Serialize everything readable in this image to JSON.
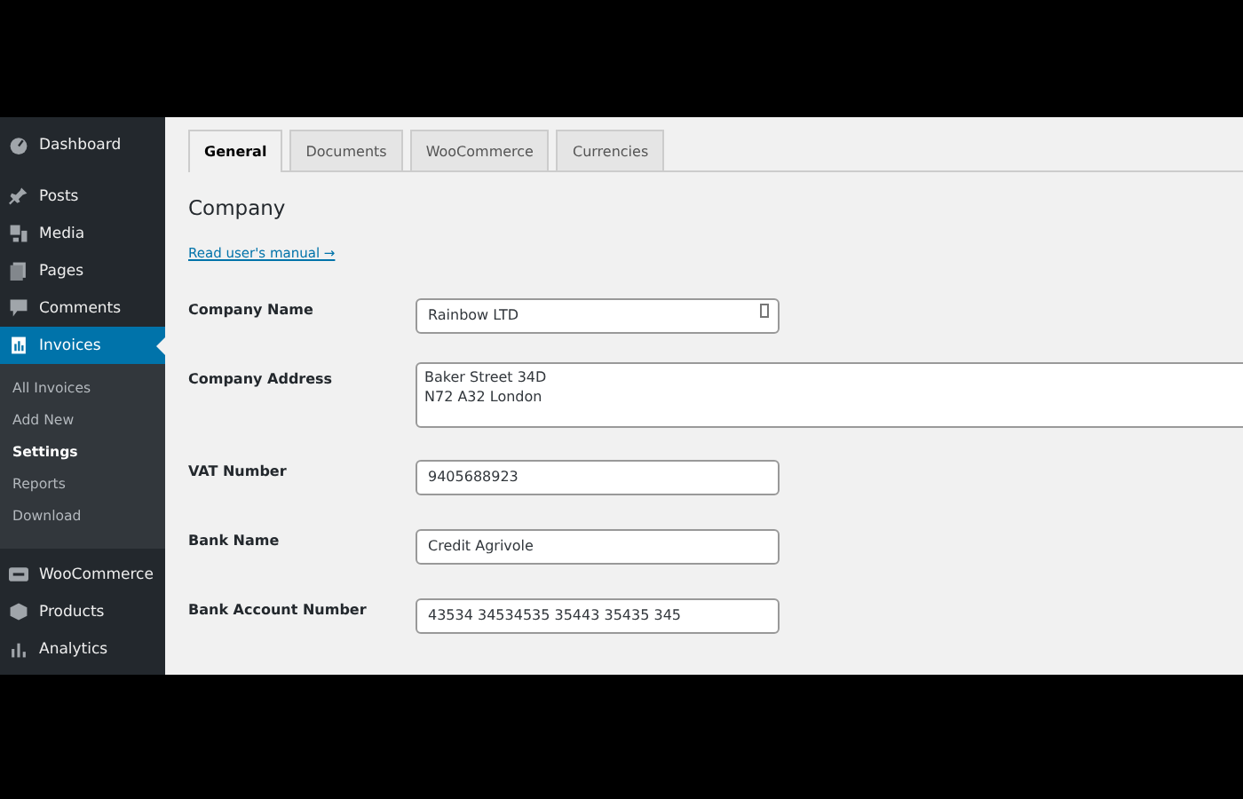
{
  "sidebar": {
    "items": [
      {
        "label": "Dashboard",
        "selected": false
      },
      {
        "label": "Posts",
        "selected": false
      },
      {
        "label": "Media",
        "selected": false
      },
      {
        "label": "Pages",
        "selected": false
      },
      {
        "label": "Comments",
        "selected": false
      },
      {
        "label": "Invoices",
        "selected": true,
        "expanded": true,
        "children": [
          {
            "label": "All Invoices",
            "selected": false
          },
          {
            "label": "Add New",
            "selected": false
          },
          {
            "label": "Settings",
            "selected": true
          },
          {
            "label": "Reports",
            "selected": false
          },
          {
            "label": "Download",
            "selected": false
          }
        ]
      },
      {
        "label": "WooCommerce",
        "selected": false
      },
      {
        "label": "Products",
        "selected": false
      },
      {
        "label": "Analytics",
        "selected": false
      }
    ]
  },
  "tabs": [
    {
      "label": "General",
      "selected": true
    },
    {
      "label": "Documents",
      "selected": false
    },
    {
      "label": "WooCommerce",
      "selected": false
    },
    {
      "label": "Currencies",
      "selected": false
    }
  ],
  "section_title": "Company",
  "manual_link": "Read user's manual →",
  "fields": [
    {
      "label": "Company Name",
      "kind": "input",
      "value": "Rainbow LTD",
      "has_autofill_icon": true
    },
    {
      "label": "Company Address",
      "kind": "textarea",
      "value": "Baker Street 34D\nN72 A32 London"
    },
    {
      "label": "VAT Number",
      "kind": "input",
      "value": "9405688923"
    },
    {
      "label": "Bank Name",
      "kind": "input",
      "value": "Credit Agrivole"
    },
    {
      "label": "Bank Account Number",
      "kind": "input",
      "value": "43534 34534535 35443 35435 345"
    }
  ]
}
